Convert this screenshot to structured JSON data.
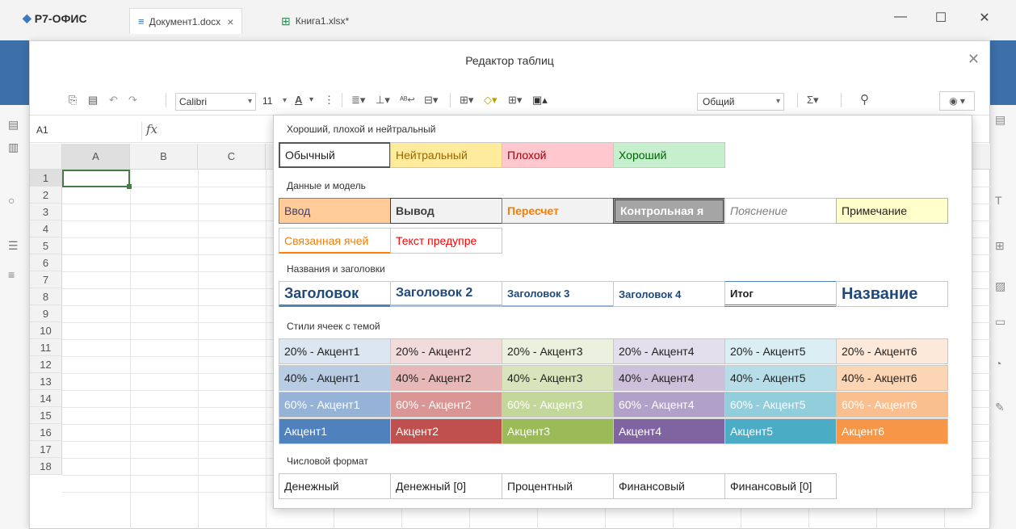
{
  "app": {
    "brand": "Р7-ОФИС",
    "tabs": [
      {
        "label": "Документ1.docx",
        "active": true
      },
      {
        "label": "Книга1.xlsx*",
        "active": false
      }
    ]
  },
  "dialog": {
    "title": "Редактор таблиц"
  },
  "toolbar": {
    "font": "Calibri",
    "size": "11",
    "number_format": "Общий"
  },
  "formula": {
    "cell_ref": "A1",
    "fx": "fx"
  },
  "grid": {
    "columns": [
      "A",
      "B",
      "C"
    ],
    "rows": [
      "1",
      "2",
      "3",
      "4",
      "5",
      "6",
      "7",
      "8",
      "9",
      "10",
      "11",
      "12",
      "13",
      "14",
      "15",
      "16",
      "17",
      "18"
    ]
  },
  "styles_popup": {
    "sections": [
      {
        "title": "Хороший, плохой и нейтральный"
      },
      {
        "title": "Данные и модель"
      },
      {
        "title": "Названия и заголовки"
      },
      {
        "title": "Стили ячеек с темой"
      },
      {
        "title": "Числовой формат"
      }
    ],
    "good_bad": [
      "Обычный",
      "Нейтральный",
      "Плохой",
      "Хороший"
    ],
    "data_model": [
      "Ввод",
      "Вывод",
      "Пересчет",
      "Контрольная я",
      "Пояснение",
      "Примечание",
      "Связанная ячей",
      "Текст предупре"
    ],
    "titles": [
      "Заголовок",
      "Заголовок 2",
      "Заголовок 3",
      "Заголовок 4",
      "Итог",
      "Название"
    ],
    "accent20": [
      "20% - Акцент1",
      "20% - Акцент2",
      "20% - Акцент3",
      "20% - Акцент4",
      "20% - Акцент5",
      "20% - Акцент6"
    ],
    "accent40": [
      "40% - Акцент1",
      "40% - Акцент2",
      "40% - Акцент3",
      "40% - Акцент4",
      "40% - Акцент5",
      "40% - Акцент6"
    ],
    "accent60": [
      "60% - Акцент1",
      "60% - Акцент2",
      "60% - Акцент3",
      "60% - Акцент4",
      "60% - Акцент5",
      "60% - Акцент6"
    ],
    "accent": [
      "Акцент1",
      "Акцент2",
      "Акцент3",
      "Акцент4",
      "Акцент5",
      "Акцент6"
    ],
    "number_formats": [
      "Денежный",
      "Денежный [0]",
      "Процентный",
      "Финансовый",
      "Финансовый [0]"
    ]
  },
  "colors": {
    "neutral_bg": "#ffeb9c",
    "neutral_fg": "#9c6500",
    "bad_bg": "#ffc7ce",
    "bad_fg": "#9c0006",
    "good_bg": "#c6efce",
    "good_fg": "#006100",
    "accent1": "#4f81bd",
    "accent2": "#c0504d",
    "accent3": "#9bbb59",
    "accent4": "#8064a2",
    "accent5": "#4bacc6",
    "accent6": "#f79646"
  }
}
